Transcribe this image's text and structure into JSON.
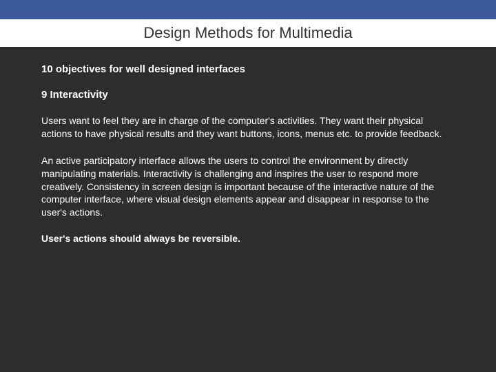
{
  "slide": {
    "title": "Design Methods for Multimedia",
    "heading": "10 objectives for well designed interfaces",
    "subheading": "9 Interactivity",
    "paragraph1": "Users want to feel they are in charge of the computer's activities. They want their physical actions to have physical results and they want buttons, icons, menus etc. to provide feedback.",
    "paragraph2": "An active participatory interface allows the users to control the environment by directly manipulating materials. Interactivity is challenging and inspires the user to respond more creatively. Consistency in screen design is important because of the interactive nature of the computer interface, where visual design elements appear and disappear in response to the user's actions.",
    "paragraph3": "User's actions should always be reversible."
  }
}
